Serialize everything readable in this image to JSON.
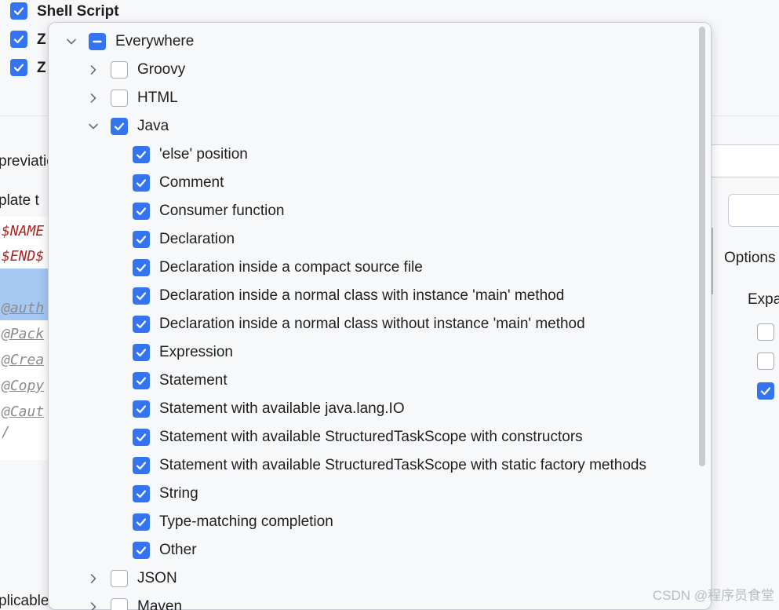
{
  "background": {
    "checkboxes": [
      {
        "label": "Shell Script",
        "checked": true
      },
      {
        "label": "Z",
        "checked": true
      },
      {
        "label": "Z",
        "checked": true
      }
    ],
    "abbreviation_label": "previatio",
    "template_text_label": "plate t",
    "code_lines": [
      "$NAME",
      "$END$",
      "@auth",
      "@Pack",
      "@Crea",
      "@Copy",
      "@Caut",
      "/"
    ],
    "options_label": "Options",
    "expand_label": "Expa",
    "applicable_label": "plicable",
    "right_checkboxes": [
      false,
      false,
      true
    ]
  },
  "popup": {
    "root": {
      "label": "Everywhere",
      "state": "mixed",
      "expanded": true
    },
    "groups": [
      {
        "label": "Groovy",
        "checked": false,
        "expanded": false
      },
      {
        "label": "HTML",
        "checked": false,
        "expanded": false
      },
      {
        "label": "Java",
        "checked": true,
        "expanded": true,
        "children": [
          "'else' position",
          "Comment",
          "Consumer function",
          "Declaration",
          "Declaration inside a compact source file",
          "Declaration inside a normal class with instance 'main' method",
          "Declaration inside a normal class without instance 'main' method",
          "Expression",
          "Statement",
          "Statement with available java.lang.IO",
          "Statement with available StructuredTaskScope with constructors",
          "Statement with available StructuredTaskScope with static factory methods",
          "String",
          "Type-matching completion",
          "Other"
        ]
      },
      {
        "label": "JSON",
        "checked": false,
        "expanded": false
      },
      {
        "label": "Maven",
        "checked": false,
        "expanded": false
      }
    ]
  },
  "watermark": "CSDN @程序员食堂",
  "colors": {
    "accent": "#3574f0",
    "popup_bg": "#f7f8fa",
    "border": "#c9ccd3"
  }
}
